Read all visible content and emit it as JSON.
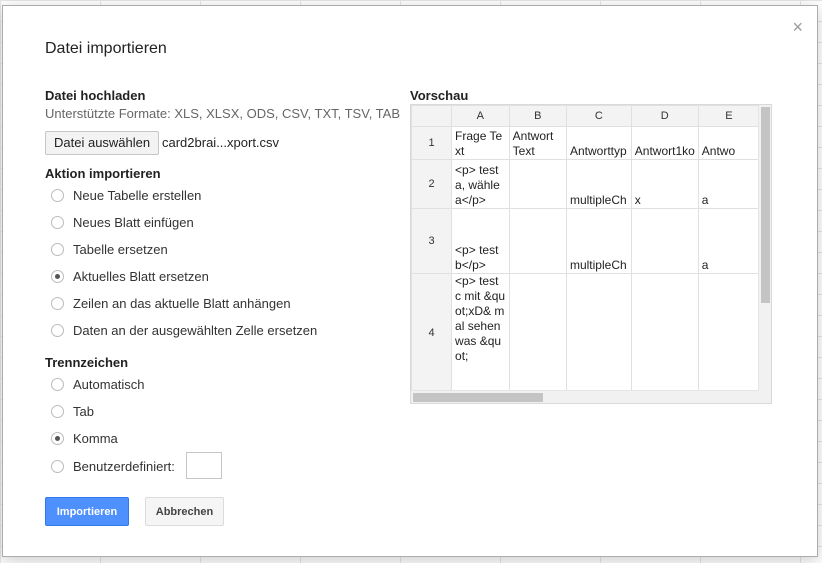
{
  "dialog": {
    "title": "Datei importieren",
    "close_label": "×"
  },
  "upload": {
    "heading": "Datei hochladen",
    "formats": "Unterstützte Formate: XLS, XLSX, ODS, CSV, TXT, TSV, TAB",
    "choose_button": "Datei auswählen",
    "file_name": "card2brai...xport.csv"
  },
  "action": {
    "heading": "Aktion importieren",
    "options": [
      {
        "label": "Neue Tabelle erstellen",
        "checked": false
      },
      {
        "label": "Neues Blatt einfügen",
        "checked": false
      },
      {
        "label": "Tabelle ersetzen",
        "checked": false
      },
      {
        "label": "Aktuelles Blatt ersetzen",
        "checked": true
      },
      {
        "label": "Zeilen an das aktuelle Blatt anhängen",
        "checked": false
      },
      {
        "label": "Daten an der ausgewählten Zelle ersetzen",
        "checked": false
      }
    ]
  },
  "separator": {
    "heading": "Trennzeichen",
    "options": [
      {
        "label": "Automatisch",
        "checked": false
      },
      {
        "label": "Tab",
        "checked": false
      },
      {
        "label": "Komma",
        "checked": true
      },
      {
        "label": "Benutzerdefiniert:",
        "checked": false
      }
    ],
    "custom_value": ""
  },
  "buttons": {
    "import": "Importieren",
    "cancel": "Abbrechen"
  },
  "preview": {
    "heading": "Vorschau",
    "columns": [
      "A",
      "B",
      "C",
      "D",
      "E"
    ],
    "rows": [
      {
        "num": "1",
        "cells": [
          "Frage Text",
          "Antwort Text",
          "Antworttyp",
          "Antwort1ko",
          "Antwo"
        ]
      },
      {
        "num": "2",
        "cells": [
          "<p> test a, wähle a</p>",
          "",
          "multipleCh",
          "x",
          "a"
        ]
      },
      {
        "num": "3",
        "cells": [
          "<p> test b</p>",
          "",
          "multipleCh",
          "",
          "a"
        ]
      },
      {
        "num": "4",
        "cells": [
          "<p> test c mit &quot;xD& mal sehen was &quot;",
          "",
          "",
          "",
          ""
        ]
      }
    ]
  },
  "colors": {
    "primary": "#4d90fe",
    "radio_dot": "#555555"
  }
}
